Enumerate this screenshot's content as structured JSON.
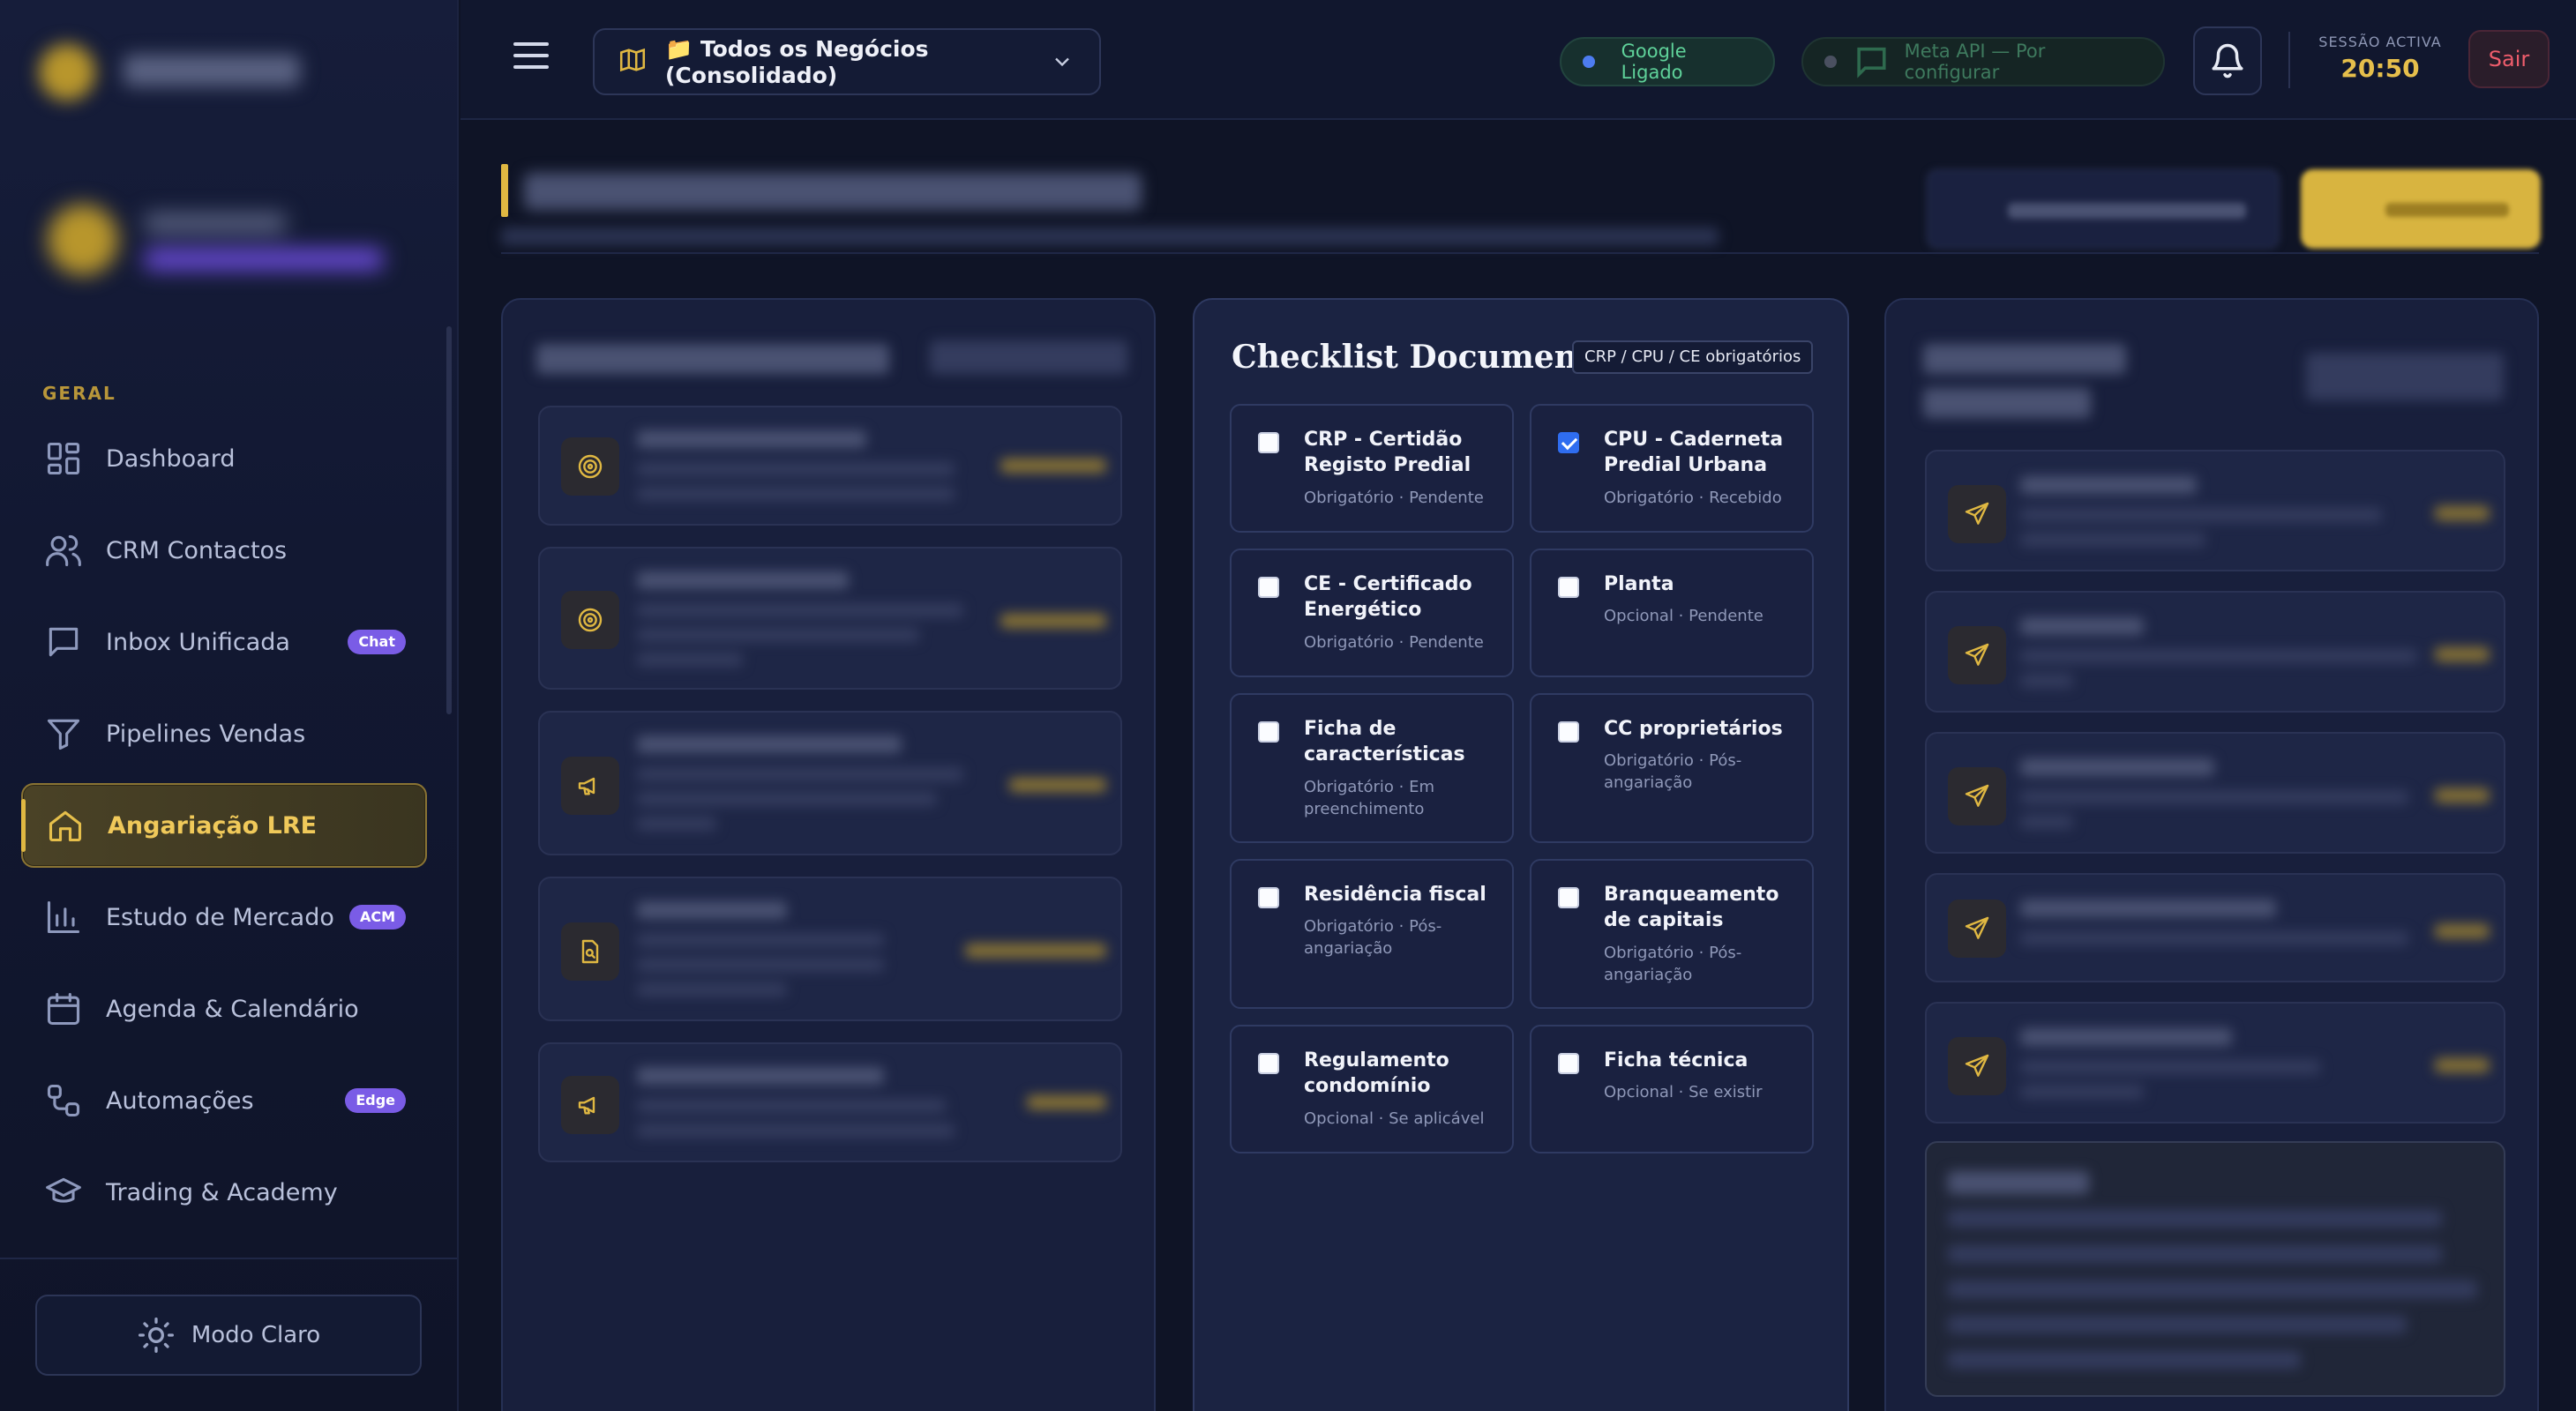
{
  "sidebar": {
    "section_label": "GERAL",
    "items": [
      {
        "label": "Dashboard",
        "icon": "dashboard-grid-icon"
      },
      {
        "label": "CRM Contactos",
        "icon": "users-icon"
      },
      {
        "label": "Inbox Unificada",
        "icon": "chat-bubble-icon",
        "badge": "Chat"
      },
      {
        "label": "Pipelines Vendas",
        "icon": "funnel-icon"
      },
      {
        "label": "Angariação LRE",
        "icon": "home-icon",
        "active": true
      },
      {
        "label": "Estudo de Mercado",
        "icon": "bar-chart-icon",
        "badge": "ACM"
      },
      {
        "label": "Agenda & Calendário",
        "icon": "calendar-icon"
      },
      {
        "label": "Automações",
        "icon": "workflow-icon",
        "badge": "Edge"
      },
      {
        "label": "Trading & Academy",
        "icon": "graduation-cap-icon"
      }
    ],
    "mode_button": "Modo Claro"
  },
  "topbar": {
    "business_selector": "📁 Todos os Negócios (Consolidado)",
    "google_status": "Google Ligado",
    "meta_status": "Meta API — Por configurar",
    "session_label": "SESSÃO ACTIVA",
    "session_time": "20:50",
    "logout": "Sair"
  },
  "checklist": {
    "title": "Checklist Documental",
    "tag": "CRP / CPU / CE obrigatórios",
    "documents": [
      {
        "name": "CRP - Certidão Registo Predial",
        "status": "Obrigatório · Pendente",
        "checked": false
      },
      {
        "name": "CPU - Caderneta Predial Urbana",
        "status": "Obrigatório · Recebido",
        "checked": true
      },
      {
        "name": "CE - Certificado Energético",
        "status": "Obrigatório · Pendente",
        "checked": false
      },
      {
        "name": "Planta",
        "status": "Opcional · Pendente",
        "checked": false
      },
      {
        "name": "Ficha de características",
        "status": "Obrigatório · Em preenchimento",
        "checked": false
      },
      {
        "name": "CC proprietários",
        "status": "Obrigatório · Pós-angariação",
        "checked": false
      },
      {
        "name": "Residência fiscal",
        "status": "Obrigatório · Pós-angariação",
        "checked": false
      },
      {
        "name": "Branqueamento de capitais",
        "status": "Obrigatório · Pós-angariação",
        "checked": false
      },
      {
        "name": "Regulamento condomínio",
        "status": "Opcional · Se aplicável",
        "checked": false
      },
      {
        "name": "Ficha técnica",
        "status": "Opcional · Se existir",
        "checked": false
      }
    ]
  },
  "colors": {
    "accent_gold": "#e0b842",
    "badge_purple": "#7a5ce6",
    "checkbox_blue": "#2f6df0",
    "logout_red": "#ef5d6c",
    "google_green": "#5fd29a"
  }
}
